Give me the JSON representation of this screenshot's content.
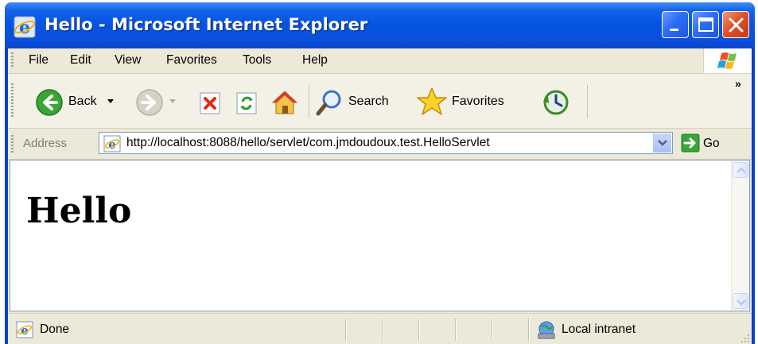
{
  "window": {
    "title": "Hello - Microsoft Internet Explorer"
  },
  "menu": {
    "items": [
      "File",
      "Edit",
      "View",
      "Favorites",
      "Tools",
      "Help"
    ]
  },
  "toolbar": {
    "back_label": "Back",
    "search_label": "Search",
    "favorites_label": "Favorites",
    "overflow": "»"
  },
  "address": {
    "label": "Address",
    "url": "http://localhost:8088/hello/servlet/com.jmdoudoux.test.HelloServlet",
    "go_label": "Go"
  },
  "page": {
    "heading": "Hello"
  },
  "status": {
    "text": "Done",
    "zone": "Local intranet"
  },
  "colors": {
    "titlebar": "#0655e3",
    "chrome": "#ece9d8",
    "close_button": "#e2512c"
  }
}
